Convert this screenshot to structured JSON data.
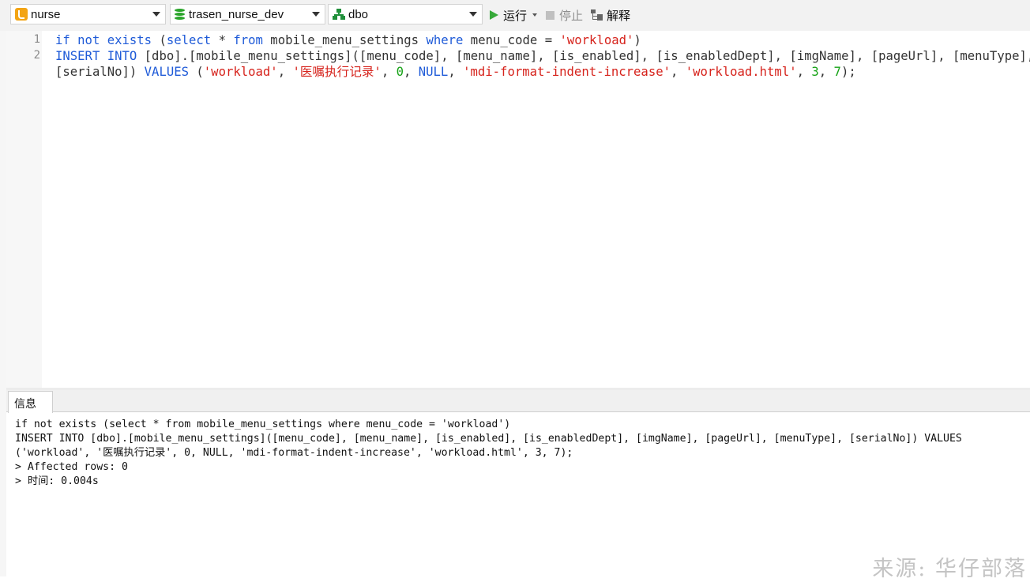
{
  "toolbar": {
    "connection": "nurse",
    "database": "trasen_nurse_dev",
    "schema": "dbo",
    "run_label": "运行",
    "stop_label": "停止",
    "explain_label": "解释"
  },
  "editor": {
    "line_numbers": [
      "1",
      "2"
    ],
    "line1": {
      "t1": "if not exists",
      "t2": " (",
      "t3": "select",
      "t4": " * ",
      "t5": "from",
      "t6": " mobile_menu_settings ",
      "t7": "where",
      "t8": " menu_code = ",
      "t9": "'workload'",
      "t10": ")"
    },
    "line2a": {
      "t1": "INSERT INTO",
      "t2": " [dbo].[mobile_menu_settings]([menu_code], [menu_name], [is_enabled], [is_enabledDept], [imgName], [pageUrl], [menuType],"
    },
    "line2b": {
      "t1": "[serialNo]) ",
      "t2": "VALUES",
      "t3": " (",
      "t4": "'workload'",
      "t5": ", ",
      "t6": "'医嘱执行记录'",
      "t7": ", ",
      "t8": "0",
      "t9": ", ",
      "t10": "NULL",
      "t11": ", ",
      "t12": "'mdi-format-indent-increase'",
      "t13": ", ",
      "t14": "'workload.html'",
      "t15": ", ",
      "t16": "3",
      "t17": ", ",
      "t18": "7",
      "t19": ");"
    }
  },
  "panel": {
    "tab_label": "信息",
    "messages": [
      "if not exists (select * from mobile_menu_settings where menu_code = 'workload')",
      "INSERT INTO [dbo].[mobile_menu_settings]([menu_code], [menu_name], [is_enabled], [is_enabledDept], [imgName], [pageUrl], [menuType], [serialNo]) VALUES",
      "('workload', '医嘱执行记录', 0, NULL, 'mdi-format-indent-increase', 'workload.html', 3, 7);",
      "> Affected rows: 0",
      "> 时间: 0.004s"
    ]
  },
  "watermark": "来源: 华仔部落",
  "colors": {
    "keyword": "#1f5bd8",
    "string": "#d6231c",
    "number": "#16a216",
    "run_icon": "#37a93a"
  },
  "icons": [
    "connection-icon",
    "database-icon",
    "schema-icon",
    "run-icon",
    "stop-icon",
    "explain-icon"
  ]
}
